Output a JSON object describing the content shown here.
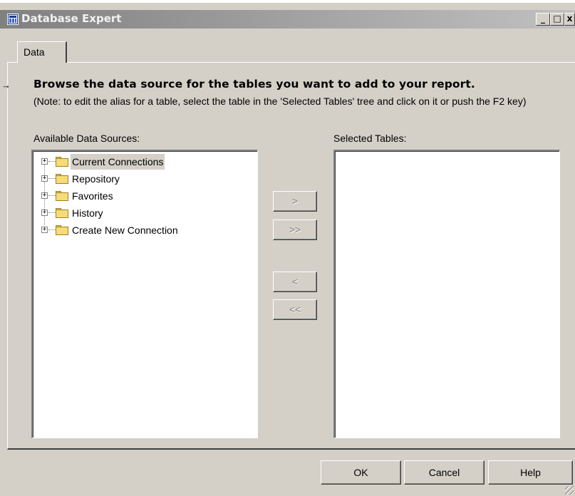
{
  "window": {
    "title": "Database Expert",
    "controls": {
      "minimize": "_",
      "maximize": "□",
      "close": "x"
    }
  },
  "tabs": [
    {
      "label": "Data",
      "selected": true
    }
  ],
  "panel": {
    "heading": "Browse the data source for the tables you want to add to your report.",
    "note": "(Note: to edit the alias for a table, select the table in the 'Selected Tables' tree and click on it or push the F2 key)",
    "available_label": "Available Data Sources:",
    "selected_label": "Selected Tables:",
    "tree": [
      {
        "label": "Current Connections",
        "icon": "folder-icon",
        "expander": "+",
        "selected": true
      },
      {
        "label": "Repository",
        "icon": "folder-icon",
        "expander": "+"
      },
      {
        "label": "Favorites",
        "icon": "folder-icon",
        "expander": "+"
      },
      {
        "label": "History",
        "icon": "folder-icon",
        "expander": "+"
      },
      {
        "label": "Create New Connection",
        "icon": "folder-icon",
        "expander": "+"
      }
    ],
    "transfer_buttons": {
      "add": ">",
      "add_all": ">>",
      "remove": "<",
      "remove_all": "<<"
    },
    "selected_tables": []
  },
  "footer": {
    "ok": "OK",
    "cancel": "Cancel",
    "help": "Help"
  },
  "colors": {
    "dialog_bg": "#d4d0c8",
    "titlebar_inactive": "#808080",
    "disabled_text": "#808080",
    "folder": "#f6dc78"
  }
}
